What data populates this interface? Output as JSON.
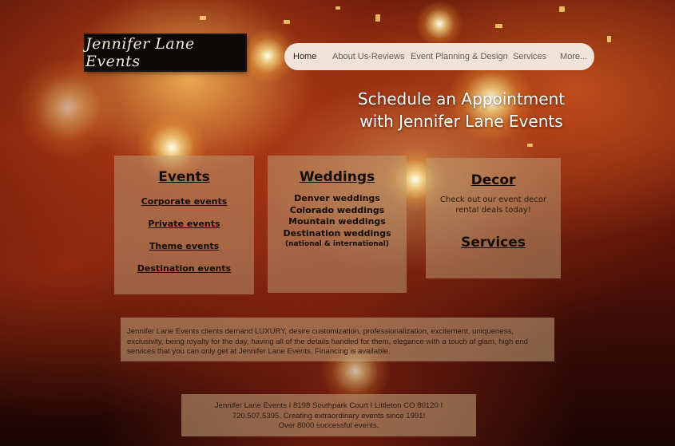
{
  "logo": {
    "text": "Jennifer Lane Events"
  },
  "nav": {
    "items": [
      {
        "label": "Home"
      },
      {
        "label": "About Us-Reviews"
      },
      {
        "label": "Event Planning & Design"
      },
      {
        "label": "Services"
      },
      {
        "label": "More..."
      }
    ]
  },
  "headline": {
    "line1": "Schedule an Appointment",
    "line2": "with Jennifer Lane Events"
  },
  "events_card": {
    "title": "Events",
    "links": [
      "Corporate events",
      "Private events",
      "Theme events",
      "Destination events"
    ]
  },
  "weddings_card": {
    "title": "Weddings",
    "lines": [
      "Denver weddings",
      "Colorado weddings",
      "Mountain weddings",
      "Destination weddings"
    ],
    "note": "(national & international)"
  },
  "decor_card": {
    "title": "Decor",
    "description_line1": "Check out our event decor",
    "description_line2": "rental deals today!",
    "services_title": "Services"
  },
  "about": {
    "line1": "Jennifer Lane Events clients demand LUXURY, desire customization, professionalization, excitement, uniqueness,",
    "line2": "exclusivity, being royalty for the day, having all of the details handled for them, elegance with a touch of glam, high end",
    "line3": "services that you can only get at Jennifer Lane Events.  Financing is available."
  },
  "footer": {
    "line1": "Jennifer Lane Events I 8198 Southpark Court  I Littleton CO 80120   I",
    "line2": "720.507.5395.   Creating extraordinary events since 1991!",
    "line3": "Over 8000 successful events."
  }
}
